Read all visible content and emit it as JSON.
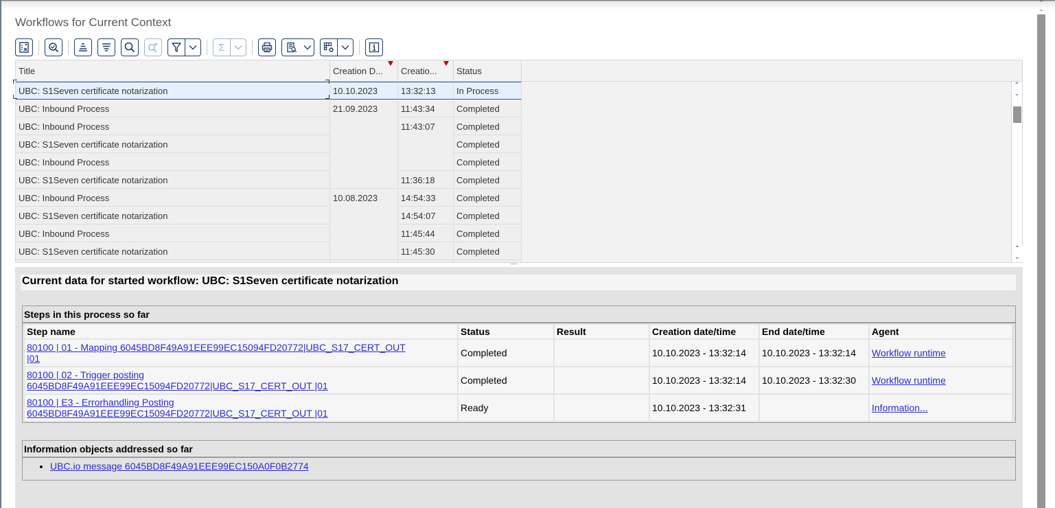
{
  "page": {
    "title": "Workflows for Current Context"
  },
  "toolbar": {
    "buttons": [
      {
        "name": "details",
        "icon": "details-icon"
      },
      {
        "name": "check",
        "icon": "check-magnifier-icon"
      },
      {
        "name": "sort-ascending",
        "icon": "sort-ascending-icon"
      },
      {
        "name": "sort-descending",
        "icon": "sort-descending-icon"
      },
      {
        "name": "find",
        "icon": "search-icon"
      },
      {
        "name": "find-next",
        "icon": "search-plus-icon",
        "disabled": true
      },
      {
        "name": "filter",
        "icon": "filter-icon",
        "dropdown": true
      },
      {
        "name": "sum",
        "icon": "sigma-icon",
        "dropdown": true,
        "disabled": true
      },
      {
        "name": "print",
        "icon": "printer-icon"
      },
      {
        "name": "views",
        "icon": "view-icon",
        "dropdown": true
      },
      {
        "name": "layout",
        "icon": "layout-settings-icon",
        "dropdown": true
      },
      {
        "name": "information",
        "icon": "info-icon"
      }
    ],
    "sigma_glyph": "Σ",
    "info_glyph": "i"
  },
  "grid": {
    "columns": [
      {
        "key": "title",
        "label": "Title"
      },
      {
        "key": "date",
        "label": "Creation D...",
        "sorted": true
      },
      {
        "key": "time",
        "label": "Creatio...",
        "sorted": true
      },
      {
        "key": "status",
        "label": "Status"
      }
    ],
    "rows": [
      {
        "title": "UBC: S1Seven certificate notarization",
        "date": "10.10.2023",
        "time": "13:32:13",
        "status": "In Process",
        "selected": true
      },
      {
        "title": "UBC: Inbound Process",
        "date": "21.09.2023",
        "time": "11:43:34",
        "status": "Completed"
      },
      {
        "title": "UBC: Inbound Process",
        "date": "",
        "time": "11:43:07",
        "status": "Completed"
      },
      {
        "title": "UBC: S1Seven certificate notarization",
        "date": "",
        "time": "",
        "status": "Completed"
      },
      {
        "title": "UBC: Inbound Process",
        "date": "",
        "time": "",
        "status": "Completed"
      },
      {
        "title": "UBC: S1Seven certificate notarization",
        "date": "",
        "time": "11:36:18",
        "status": "Completed"
      },
      {
        "title": "UBC: Inbound Process",
        "date": "10.08.2023",
        "time": "14:54:33",
        "status": "Completed"
      },
      {
        "title": "UBC: S1Seven certificate notarization",
        "date": "",
        "time": "14:54:07",
        "status": "Completed"
      },
      {
        "title": "UBC: Inbound Process",
        "date": "",
        "time": "11:45:44",
        "status": "Completed"
      },
      {
        "title": "UBC: S1Seven certificate notarization",
        "date": "",
        "time": "11:45:30",
        "status": "Completed"
      }
    ],
    "splitter_glyph": "····"
  },
  "detail": {
    "title": "Current data for started workflow: UBC: S1Seven certificate notarization",
    "steps_heading": "Steps in this process so far",
    "steps_columns": [
      "Step name",
      "Status",
      "Result",
      "Creation date/time",
      "End date/time",
      "Agent"
    ],
    "steps": [
      {
        "name_line1": "80100 | 01 - Mapping 6045BD8F49A91EEE99EC15094FD20772|UBC_S17_CERT_OUT",
        "name_line2": "|01",
        "status": "Completed",
        "result": "",
        "created": "10.10.2023 - 13:32:14",
        "ended": "10.10.2023 - 13:32:14",
        "agent": "Workflow runtime"
      },
      {
        "name_line1": "80100 | 02 - Trigger posting",
        "name_line2": "6045BD8F49A91EEE99EC15094FD20772|UBC_S17_CERT_OUT |01",
        "status": "Completed",
        "result": "",
        "created": "10.10.2023 - 13:32:14",
        "ended": "10.10.2023 - 13:32:30",
        "agent": "Workflow runtime"
      },
      {
        "name_line1": "80100 | E3 - Errorhandling Posting",
        "name_line2": "6045BD8F49A91EEE99EC15094FD20772|UBC_S17_CERT_OUT |01",
        "status": "Ready",
        "result": "",
        "created": "10.10.2023 - 13:32:31",
        "ended": "",
        "agent": "Information..."
      }
    ],
    "info_heading": "Information objects addressed so far",
    "info_objects": [
      {
        "label": "UBC.io message 6045BD8F49A91EEE99EC150A0F0B2774"
      }
    ]
  },
  "colors": {
    "link": "#2b2bd4",
    "toolbar_border": "#1d3d6b",
    "selection_bg": "#e5f0fa",
    "selection_border": "#2c5aa0",
    "sort_marker": "#bb0000"
  }
}
